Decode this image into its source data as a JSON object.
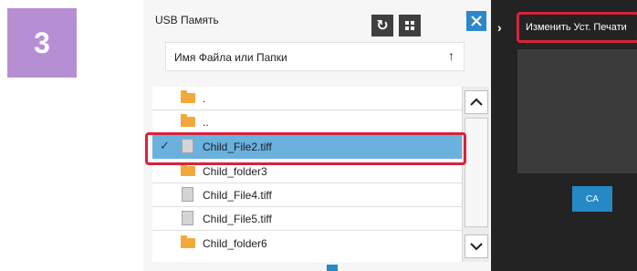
{
  "step": {
    "number": "3"
  },
  "dialog": {
    "title": "USB Память",
    "refresh_icon": "↻",
    "sort": {
      "label": "Имя Файла или Папки",
      "arrow": "↑"
    },
    "items": [
      {
        "label": ".",
        "type": "folder",
        "selected": false
      },
      {
        "label": "..",
        "type": "folder",
        "selected": false
      },
      {
        "label": "Child_File2.tiff",
        "type": "file",
        "selected": true,
        "check": "✓"
      },
      {
        "label": "Child_folder3",
        "type": "folder",
        "selected": false
      },
      {
        "label": "Child_File4.tiff",
        "type": "file",
        "selected": false
      },
      {
        "label": "Child_File5.tiff",
        "type": "file",
        "selected": false
      },
      {
        "label": "Child_folder6",
        "type": "folder",
        "selected": false
      }
    ]
  },
  "right_panel": {
    "tab_arrow": "›",
    "print_setup_label": "Изменить Уст. Печати",
    "ca_label": "CA"
  },
  "colors": {
    "step_badge": "#b68ed3",
    "selection": "#6ab1de",
    "highlight_frame": "#d8223c",
    "close_button": "#2c88c8",
    "ca_button": "#2788c6",
    "folder": "#f2a93b"
  }
}
